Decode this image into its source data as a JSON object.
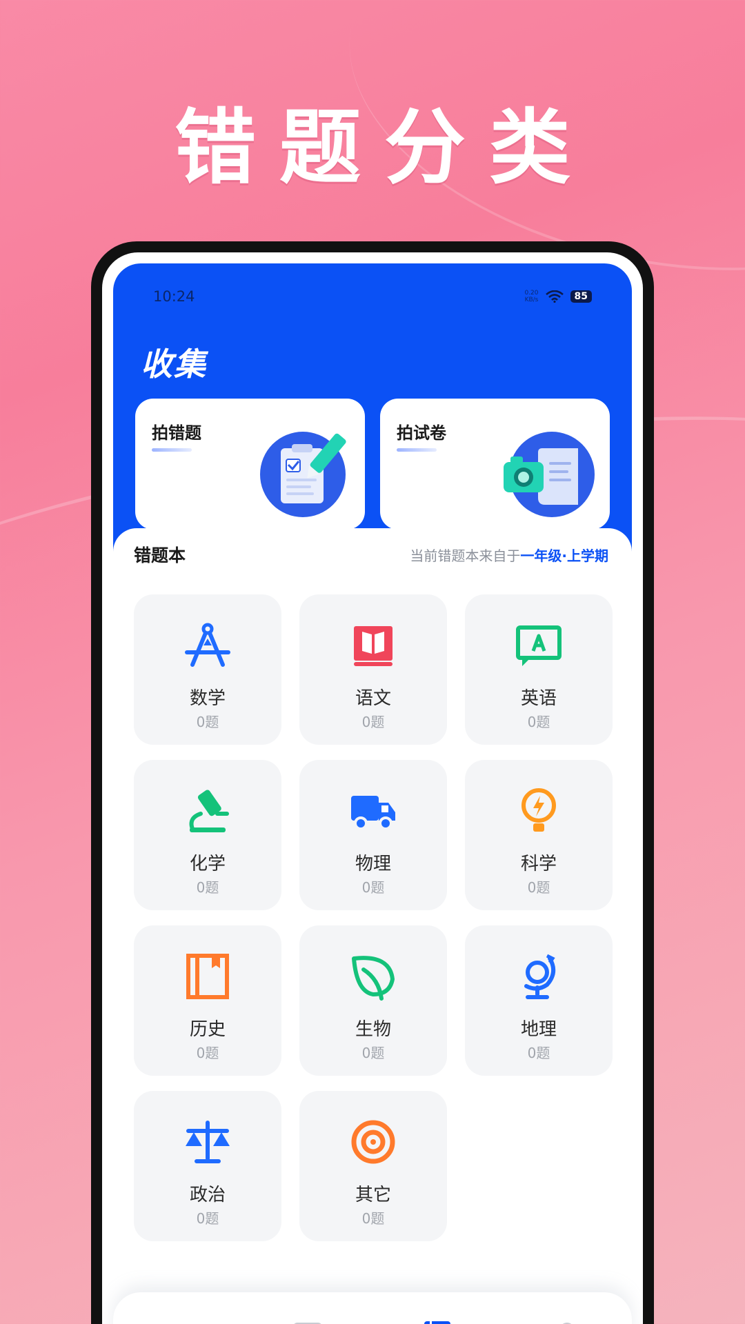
{
  "headline": "错题分类",
  "status": {
    "time": "10:24",
    "net_speed_value": "0.20",
    "net_speed_unit": "KB/s",
    "battery": "85"
  },
  "collect": {
    "title": "收集",
    "cards": [
      {
        "label": "拍错题"
      },
      {
        "label": "拍试卷"
      }
    ]
  },
  "book": {
    "title": "错题本",
    "source_prefix": "当前错题本来自于",
    "source_value": "一年级·上学期"
  },
  "subjects": [
    {
      "name": "数学",
      "count": "0题",
      "icon": "compass-icon",
      "color": "#1f6bff"
    },
    {
      "name": "语文",
      "count": "0题",
      "icon": "book-icon",
      "color": "#f0455a"
    },
    {
      "name": "英语",
      "count": "0题",
      "icon": "letter-board-icon",
      "color": "#14c27a"
    },
    {
      "name": "化学",
      "count": "0题",
      "icon": "microscope-icon",
      "color": "#14c27a"
    },
    {
      "name": "物理",
      "count": "0题",
      "icon": "truck-icon",
      "color": "#1f6bff"
    },
    {
      "name": "科学",
      "count": "0题",
      "icon": "lightbulb-icon",
      "color": "#ff9a1f"
    },
    {
      "name": "历史",
      "count": "0题",
      "icon": "archive-book-icon",
      "color": "#ff7a2c"
    },
    {
      "name": "生物",
      "count": "0题",
      "icon": "leaf-icon",
      "color": "#14c27a"
    },
    {
      "name": "地理",
      "count": "0题",
      "icon": "globe-icon",
      "color": "#1f6bff"
    },
    {
      "name": "政治",
      "count": "0题",
      "icon": "scale-icon",
      "color": "#1f6bff"
    },
    {
      "name": "其它",
      "count": "0题",
      "icon": "target-icon",
      "color": "#ff7a2c"
    }
  ],
  "tabs": [
    {
      "icon": "home-icon",
      "active": false
    },
    {
      "icon": "transfer-icon",
      "active": false
    },
    {
      "icon": "wrong-book-icon",
      "active": true
    },
    {
      "icon": "profile-icon",
      "active": false
    }
  ],
  "colors": {
    "primary": "#0b51f5",
    "inactive_tab": "#c9ccd2"
  }
}
